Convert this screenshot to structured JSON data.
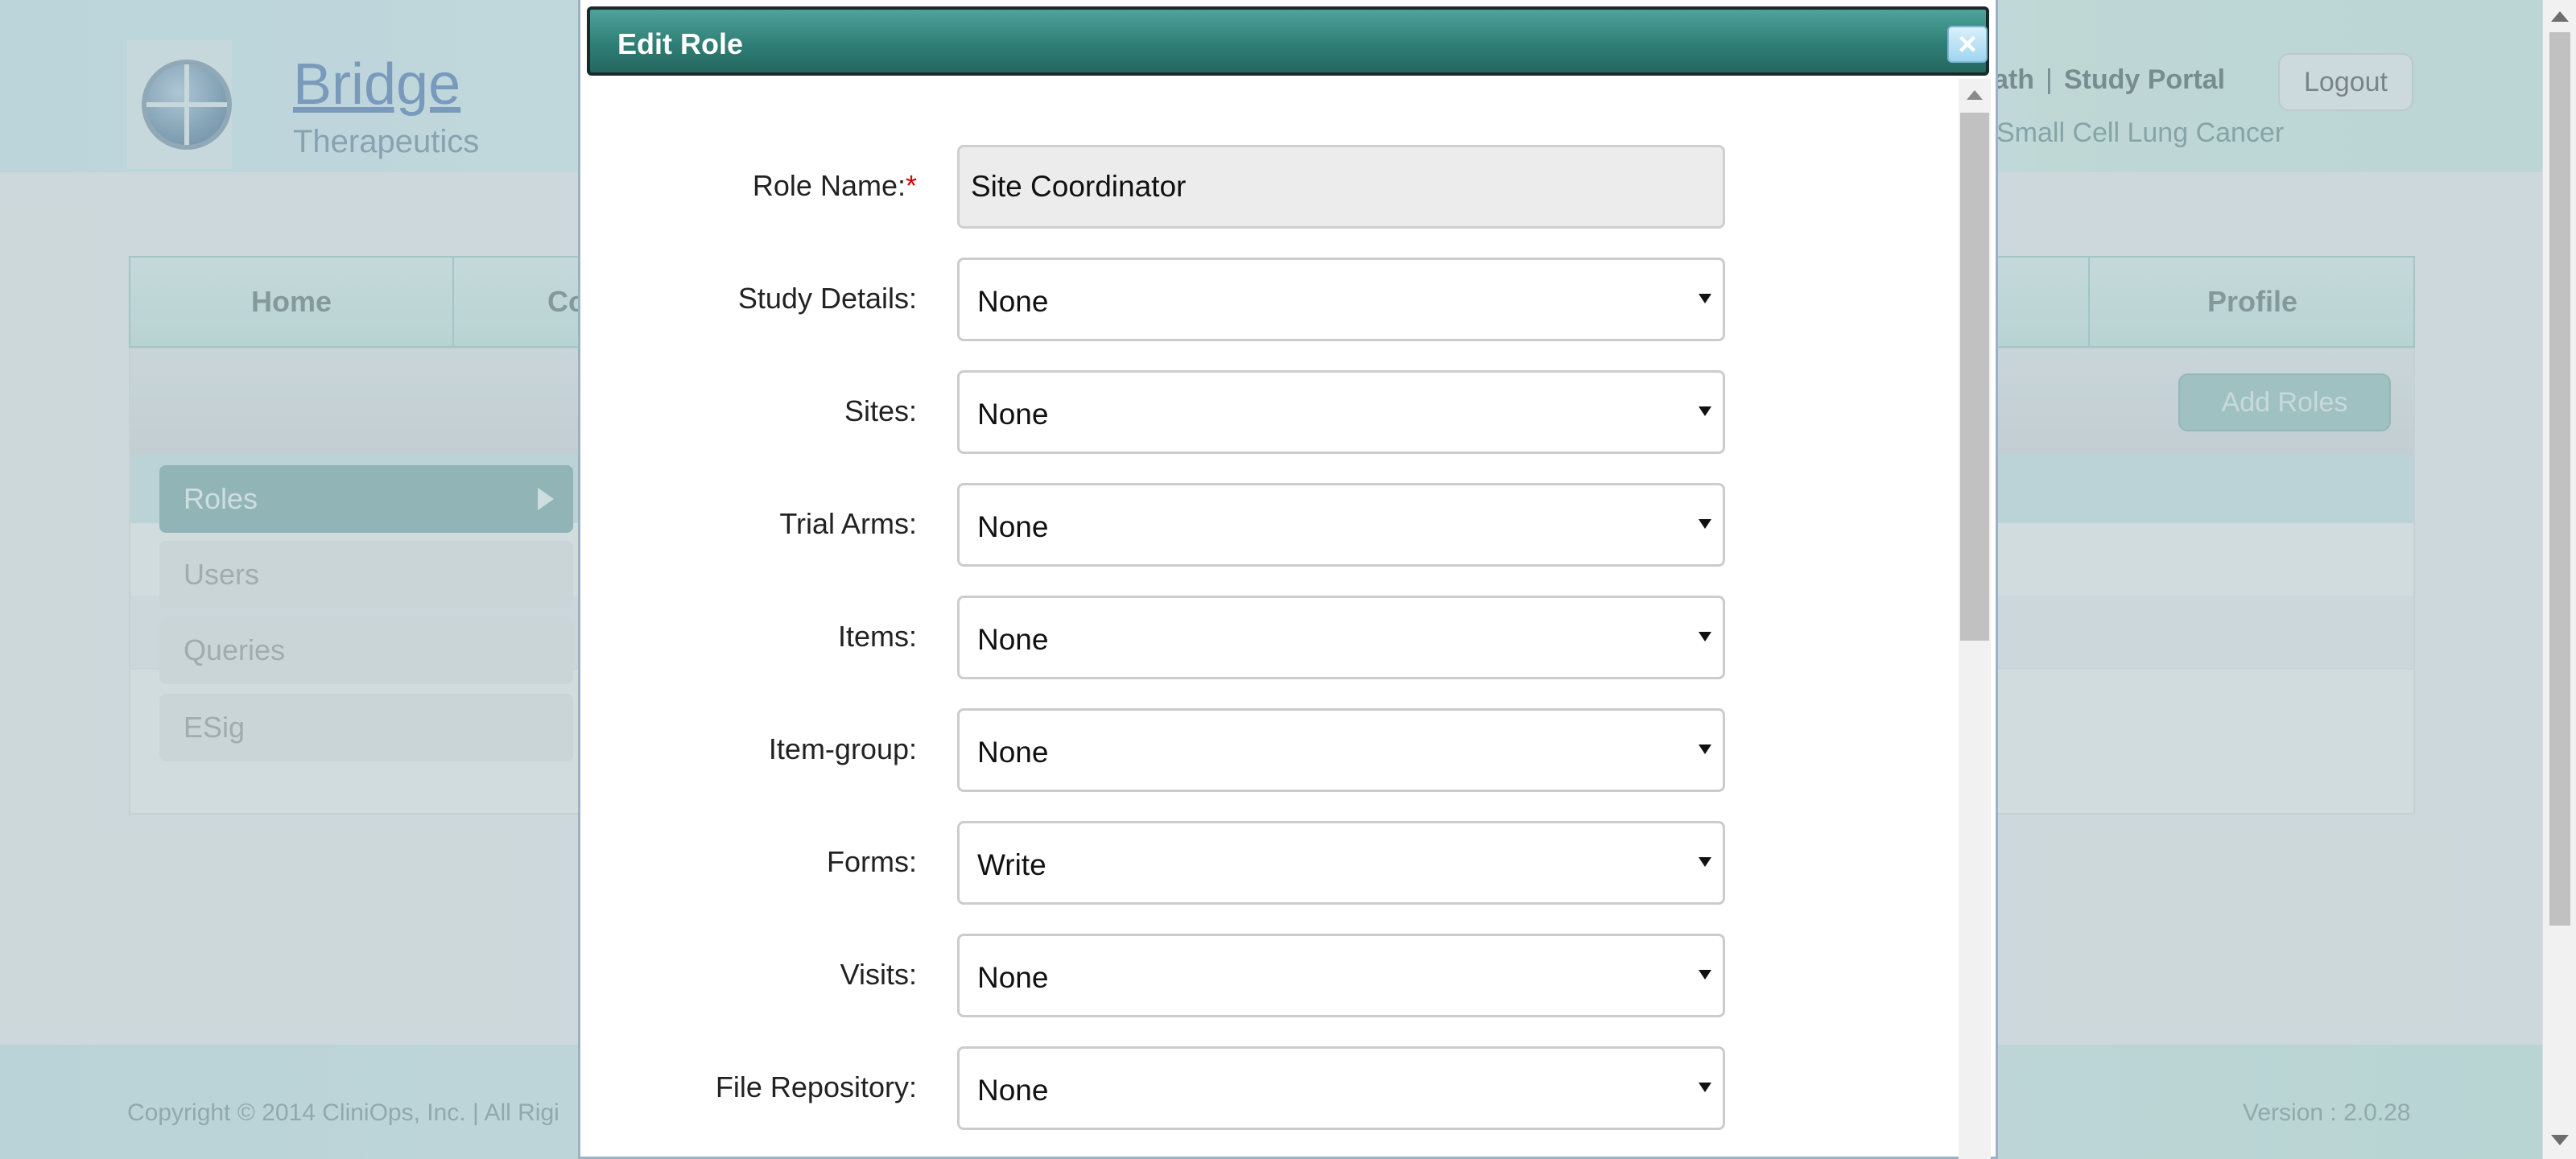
{
  "header": {
    "logo_text_1": "Bridge",
    "logo_text_2": "Therapeutics",
    "link_partial": "ath",
    "link_separator": "|",
    "link_study_portal": "Study Portal",
    "logout_label": "Logout",
    "subtitle": "Small Cell Lung Cancer"
  },
  "nav": {
    "tabs": [
      {
        "label": "Home"
      },
      {
        "label": "Co"
      },
      {
        "label": "Profile"
      }
    ]
  },
  "toolbar": {
    "add_roles_label": "Add Roles"
  },
  "sidebar": {
    "items": [
      {
        "label": "Roles",
        "active": true
      },
      {
        "label": "Users"
      },
      {
        "label": "Queries"
      },
      {
        "label": "ESig"
      }
    ]
  },
  "footer": {
    "copyright": "Copyright © 2014 CliniOps, Inc. | All Rigi",
    "version": "Version : 2.0.28"
  },
  "dialog": {
    "title": "Edit Role",
    "close_symbol": "×",
    "role_name_label": "Role Name:",
    "required_mark": "*",
    "role_name_value": "Site Coordinator",
    "fields": [
      {
        "label": "Study Details:",
        "value": "None"
      },
      {
        "label": "Sites:",
        "value": "None"
      },
      {
        "label": "Trial Arms:",
        "value": "None"
      },
      {
        "label": "Items:",
        "value": "None"
      },
      {
        "label": "Item-group:",
        "value": "None"
      },
      {
        "label": "Forms:",
        "value": "Write"
      },
      {
        "label": "Visits:",
        "value": "None"
      },
      {
        "label": "File Repository:",
        "value": "None"
      }
    ]
  },
  "colors": {
    "dialog_title_bar": "#2f7f76",
    "required": "#d40000",
    "sidebar_active": "#9ec1bf"
  },
  "icons": [
    "close-icon",
    "chevron-right-icon",
    "chevron-down-icon",
    "logo-icon"
  ]
}
